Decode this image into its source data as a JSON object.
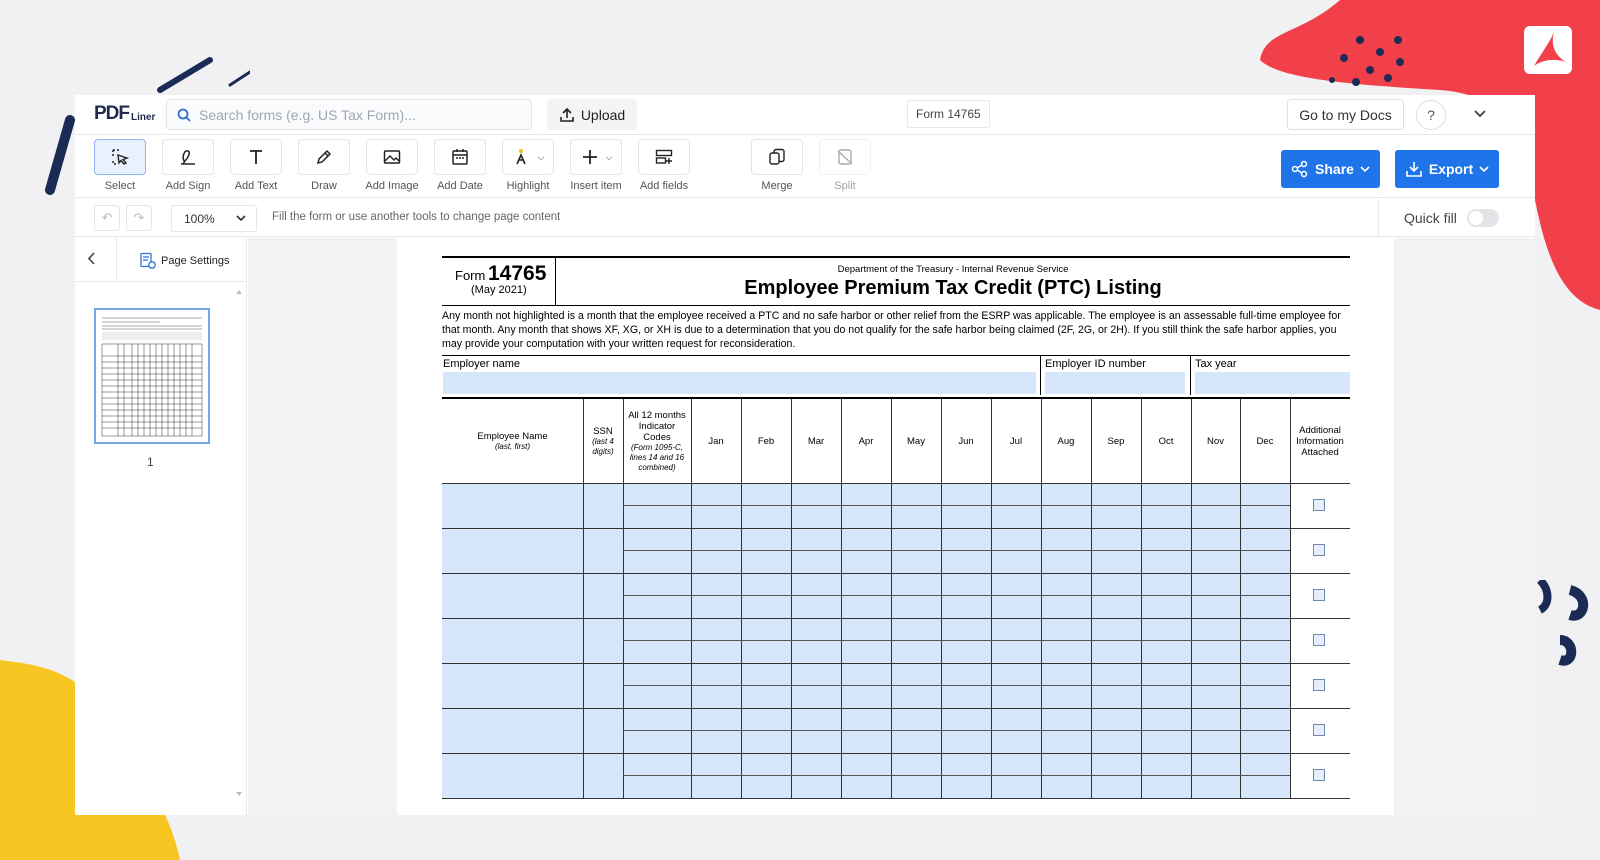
{
  "app": {
    "logo_text": "PDF",
    "logo_sub": "Liner",
    "search_placeholder": "Search forms (e.g. US Tax Form)...",
    "upload_label": "Upload",
    "document_name": "Form 14765",
    "go_to_docs_label": "Go to my Docs",
    "help_label": "?"
  },
  "toolbar": {
    "tools": [
      {
        "label": "Select",
        "icon": "select-cursor-icon"
      },
      {
        "label": "Add Sign",
        "icon": "signature-icon"
      },
      {
        "label": "Add Text",
        "icon": "text-icon"
      },
      {
        "label": "Draw",
        "icon": "pen-icon"
      },
      {
        "label": "Add Image",
        "icon": "image-icon"
      },
      {
        "label": "Add Date",
        "icon": "calendar-icon"
      },
      {
        "label": "Highlight",
        "icon": "highlighter-icon"
      },
      {
        "label": "Insert item",
        "icon": "plus-icon"
      },
      {
        "label": "Add fields",
        "icon": "fields-icon"
      },
      {
        "label": "Merge",
        "icon": "merge-icon"
      },
      {
        "label": "Split",
        "icon": "split-icon"
      }
    ],
    "share_label": "Share",
    "export_label": "Export"
  },
  "subbar": {
    "zoom": "100%",
    "hint": "Fill the form or use another tools to change page content",
    "quick_fill_label": "Quick fill",
    "quick_fill_on": false
  },
  "left_panel": {
    "page_settings_label": "Page Settings",
    "page_number": "1"
  },
  "form": {
    "form_word": "Form",
    "form_number": "14765",
    "form_date": "(May 2021)",
    "department": "Department of the Treasury - Internal Revenue Service",
    "title": "Employee Premium Tax Credit (PTC) Listing",
    "intro": "Any month not highlighted is a month that the employee received a PTC and no safe harbor or other relief from the ESRP was applicable. The employee is an assessable full-time employee for that month. Any month that shows XF, XG, or XH is due to a determination that you do not qualify for the safe harbor being claimed (2F, 2G, or 2H). If you still think the safe harbor applies, you may provide your computation with your written request for reconsideration.",
    "employer_name_label": "Employer name",
    "employer_id_label": "Employer ID number",
    "tax_year_label": "Tax year",
    "col_employee": "Employee Name",
    "col_employee_sub": "(last, first)",
    "col_ssn": "SSN",
    "col_ssn_sub": "(last 4 digits)",
    "col_all12": "All 12 months Indicator Codes",
    "col_all12_sub": "(Form 1095-C, lines 14 and 16 combined)",
    "months": [
      "Jan",
      "Feb",
      "Mar",
      "Apr",
      "May",
      "Jun",
      "Jul",
      "Aug",
      "Sep",
      "Oct",
      "Nov",
      "Dec"
    ],
    "col_additional": "Additional Information Attached"
  },
  "colors": {
    "accent": "#1e74e8",
    "field_fill": "#d6e6fb",
    "deco_red": "#f2404a",
    "deco_yellow": "#f8c623",
    "deco_navy": "#1c2b55"
  }
}
